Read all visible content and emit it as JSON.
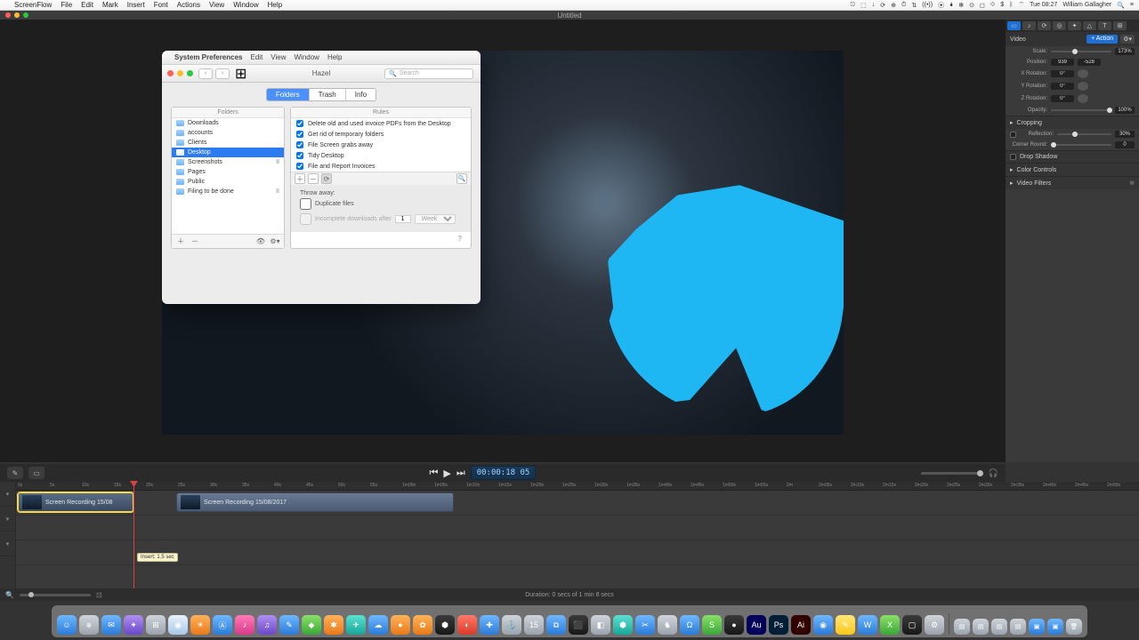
{
  "menubar": {
    "app": "ScreenFlow",
    "menus": [
      "File",
      "Edit",
      "Mark",
      "Insert",
      "Font",
      "Actions",
      "View",
      "Window",
      "Help"
    ],
    "right_time": "Tue 08:27",
    "right_user": "William Gallagher"
  },
  "window": {
    "title": "Untitled"
  },
  "inspector": {
    "header_label": "Video",
    "action_btn": "+ Action",
    "scale": {
      "label": "Scale:",
      "value": "173%"
    },
    "position": {
      "label": "Position:",
      "x": "939",
      "y": "-528"
    },
    "xrot": {
      "label": "X Rotation:",
      "value": "0°"
    },
    "yrot": {
      "label": "Y Rotation:",
      "value": "0°"
    },
    "zrot": {
      "label": "Z Rotation:",
      "value": "0°"
    },
    "opacity": {
      "label": "Opacity:",
      "value": "100%"
    },
    "sections": {
      "cropping": "Cropping",
      "reflection": {
        "label": "Reflection:",
        "value": "30%"
      },
      "corner": {
        "label": "Corner Round:",
        "value": "0"
      },
      "dropshadow": "Drop Shadow",
      "colorcontrols": "Color Controls",
      "videofilters": "Video Filters"
    }
  },
  "syspref": {
    "app_menu": [
      "System Preferences",
      "Edit",
      "View",
      "Window",
      "Help"
    ],
    "window_title": "Hazel",
    "search_placeholder": "Search",
    "tabs": [
      "Folders",
      "Trash",
      "Info"
    ],
    "folders_header": "Folders",
    "rules_header": "Rules",
    "folders": [
      {
        "name": "Downloads",
        "state": ""
      },
      {
        "name": "accounts",
        "state": ""
      },
      {
        "name": "Clients",
        "state": ""
      },
      {
        "name": "Desktop",
        "state": "",
        "selected": true
      },
      {
        "name": "Screenshots",
        "state": "II"
      },
      {
        "name": "Pages",
        "state": ""
      },
      {
        "name": "Public",
        "state": ""
      },
      {
        "name": "Filing to be done",
        "state": "II"
      }
    ],
    "rules": [
      "Delete old and used invoice PDFs from the Desktop",
      "Get rid of temporary folders",
      "File Screen grabs away",
      "Tidy Desktop",
      "File and Report Invoices"
    ],
    "throw_away_label": "Throw away:",
    "throw_dup": "Duplicate files",
    "throw_incomplete": "Incomplete downloads after",
    "throw_period_value": "1",
    "throw_period_unit": "Week"
  },
  "playbar": {
    "timecode": "00:00:18 05"
  },
  "timeline": {
    "ruler": [
      "0s",
      "5s",
      "10s",
      "15s",
      "20s",
      "25s",
      "30s",
      "35s",
      "40s",
      "45s",
      "50s",
      "55s",
      "1m00s",
      "1m05s",
      "1m10s",
      "1m15s",
      "1m20s",
      "1m25s",
      "1m30s",
      "1m35s",
      "1m40s",
      "1m45s",
      "1m50s",
      "1m55s",
      "2m",
      "2m05s",
      "2m10s",
      "2m15s",
      "2m20s",
      "2m25s",
      "2m30s",
      "2m35s",
      "2m40s",
      "2m45s",
      "2m50s"
    ],
    "clip1": "Screen Recording 15/08",
    "clip2": "Screen Recording 15/08/2017",
    "tooltip": "Insert: 1.5 sec",
    "duration": "Duration: 0 secs of 1 min 8 secs"
  }
}
